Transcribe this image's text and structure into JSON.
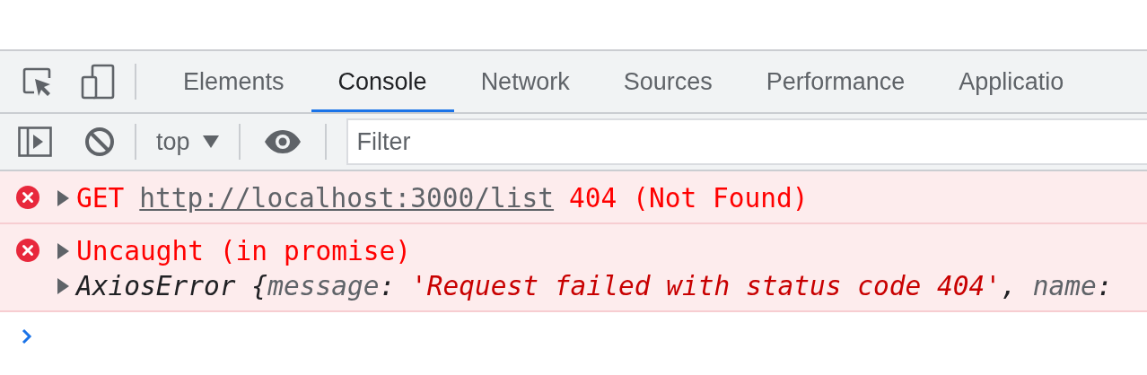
{
  "tabs": [
    {
      "label": "Elements",
      "selected": false
    },
    {
      "label": "Console",
      "selected": true
    },
    {
      "label": "Network",
      "selected": false
    },
    {
      "label": "Sources",
      "selected": false
    },
    {
      "label": "Performance",
      "selected": false
    },
    {
      "label": "Applicatio",
      "selected": false
    }
  ],
  "console_toolbar": {
    "context": "top",
    "filter": {
      "placeholder": "Filter"
    }
  },
  "messages": [
    {
      "kind": "error",
      "expanded": false,
      "method": "GET",
      "url": "http://localhost:3000/list",
      "status": "404 (Not Found)"
    },
    {
      "kind": "error",
      "expanded": false,
      "text": "Uncaught (in promise)",
      "object": {
        "expanded": false,
        "tokens": [
          {
            "kind": "type",
            "text": "AxiosError"
          },
          {
            "kind": "punct",
            "text": " {"
          },
          {
            "kind": "key",
            "text": "message"
          },
          {
            "kind": "punct",
            "text": ": "
          },
          {
            "kind": "string",
            "text": "'Request failed with status code 404'"
          },
          {
            "kind": "punct",
            "text": ", "
          },
          {
            "kind": "key",
            "text": "name"
          },
          {
            "kind": "punct",
            "text": ":"
          }
        ]
      }
    }
  ]
}
